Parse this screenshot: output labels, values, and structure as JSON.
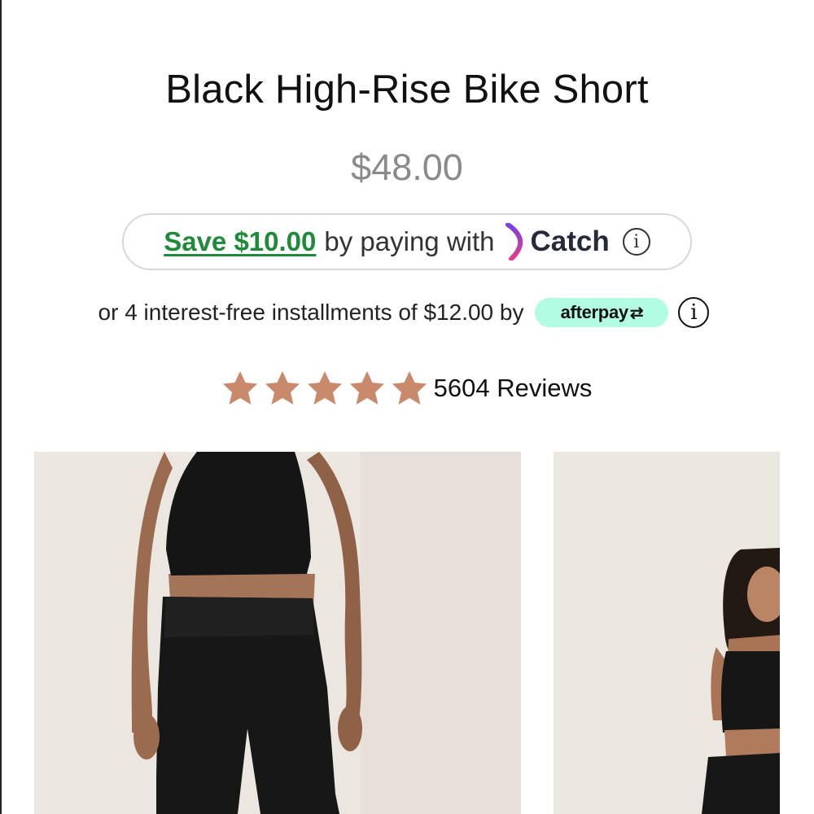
{
  "product": {
    "title": "Black High-Rise Bike Short",
    "price": "$48.00"
  },
  "catch": {
    "save_label": "Save $10.00",
    "by_label": "by paying with",
    "brand": "Catch",
    "info_icon": "info-icon",
    "save_color": "#1f8a3a"
  },
  "afterpay": {
    "text": "or 4 interest-free installments of $12.00 by",
    "badge": "afterpay",
    "badge_color": "#b2fce4",
    "info_icon": "info-icon"
  },
  "rating": {
    "stars": 5,
    "max_stars": 5,
    "star_color": "#c98a6c",
    "reviews_label": "5604 Reviews"
  },
  "gallery": {
    "images": [
      {
        "icon": "product-photo"
      },
      {
        "icon": "product-photo"
      }
    ]
  }
}
